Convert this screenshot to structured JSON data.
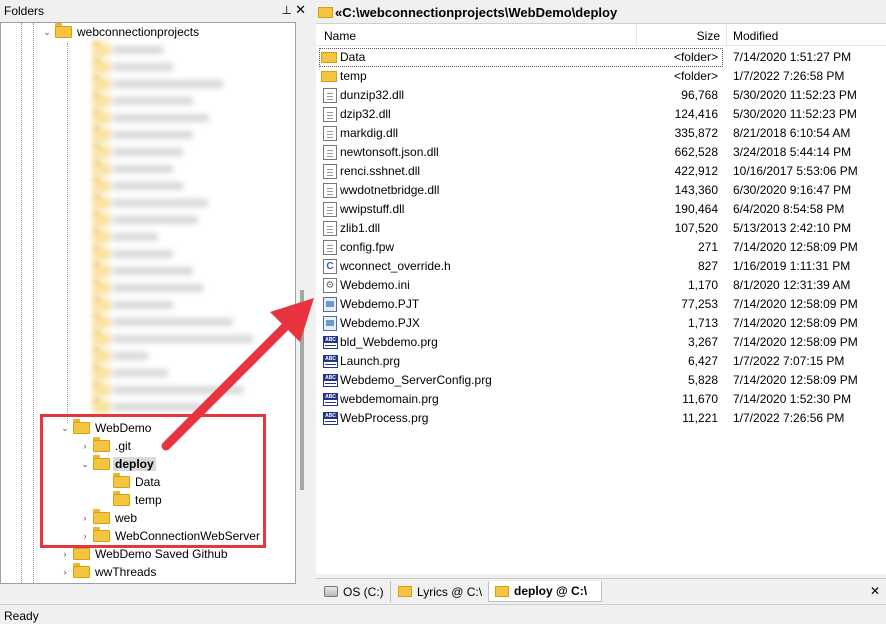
{
  "folders_pane": {
    "title": "Folders",
    "pin_glyph": "⊥",
    "close_glyph": "✕",
    "tree": {
      "root": "webconnectionprojects",
      "blurred_items": [
        "",
        "",
        "",
        "",
        "",
        "",
        "",
        "",
        "",
        "",
        "",
        "",
        "",
        "",
        "",
        "",
        "",
        "",
        "",
        "",
        "",
        ""
      ],
      "webdemo": "WebDemo",
      "git": ".git",
      "deploy": "deploy",
      "data": "Data",
      "temp": "temp",
      "web": "web",
      "wcws": "WebConnectionWebServer",
      "saved": "WebDemo Saved Github",
      "wwthreads": "wwThreads"
    }
  },
  "path_bar": {
    "prefix": "«",
    "path": "C:\\webconnectionprojects\\WebDemo\\deploy"
  },
  "file_list": {
    "columns": {
      "name": "Name",
      "size": "Size",
      "modified": "Modified"
    },
    "rows": [
      {
        "icon": "folder-icon",
        "name": "Data",
        "size": "<folder>",
        "modified": "7/14/2020 1:51:27 PM"
      },
      {
        "icon": "folder-icon",
        "name": "temp",
        "size": "<folder>",
        "modified": "1/7/2022 7:26:58 PM"
      },
      {
        "icon": "dll-file-icon",
        "name": "dunzip32.dll",
        "size": "96,768",
        "modified": "5/30/2020 11:52:23 PM"
      },
      {
        "icon": "dll-file-icon",
        "name": "dzip32.dll",
        "size": "124,416",
        "modified": "5/30/2020 11:52:23 PM"
      },
      {
        "icon": "dll-file-icon",
        "name": "markdig.dll",
        "size": "335,872",
        "modified": "8/21/2018 6:10:54 AM"
      },
      {
        "icon": "dll-file-icon",
        "name": "newtonsoft.json.dll",
        "size": "662,528",
        "modified": "3/24/2018 5:44:14 PM"
      },
      {
        "icon": "dll-file-icon",
        "name": "renci.sshnet.dll",
        "size": "422,912",
        "modified": "10/16/2017 5:53:06 PM"
      },
      {
        "icon": "dll-file-icon",
        "name": "wwdotnetbridge.dll",
        "size": "143,360",
        "modified": "6/30/2020 9:16:47 PM"
      },
      {
        "icon": "dll-file-icon",
        "name": "wwipstuff.dll",
        "size": "190,464",
        "modified": "6/4/2020 8:54:58 PM"
      },
      {
        "icon": "dll-file-icon",
        "name": "zlib1.dll",
        "size": "107,520",
        "modified": "5/13/2013 2:42:10 PM"
      },
      {
        "icon": "blank-file-icon",
        "name": "config.fpw",
        "size": "271",
        "modified": "7/14/2020 12:58:09 PM"
      },
      {
        "icon": "c-header-icon",
        "name": "wconnect_override.h",
        "size": "827",
        "modified": "1/16/2019 1:11:31 PM"
      },
      {
        "icon": "ini-gear-icon",
        "name": "Webdemo.ini",
        "size": "1,170",
        "modified": "8/1/2020 12:31:39 AM"
      },
      {
        "icon": "project-file-icon",
        "name": "Webdemo.PJT",
        "size": "77,253",
        "modified": "7/14/2020 12:58:09 PM"
      },
      {
        "icon": "project-file-icon",
        "name": "Webdemo.PJX",
        "size": "1,713",
        "modified": "7/14/2020 12:58:09 PM"
      },
      {
        "icon": "prg-file-icon",
        "name": "bld_Webdemo.prg",
        "size": "3,267",
        "modified": "7/14/2020 12:58:09 PM"
      },
      {
        "icon": "prg-file-icon",
        "name": "Launch.prg",
        "size": "6,427",
        "modified": "1/7/2022 7:07:15 PM"
      },
      {
        "icon": "prg-file-icon",
        "name": "Webdemo_ServerConfig.prg",
        "size": "5,828",
        "modified": "7/14/2020 12:58:09 PM"
      },
      {
        "icon": "prg-file-icon",
        "name": "webdemomain.prg",
        "size": "11,670",
        "modified": "7/14/2020 1:52:30 PM"
      },
      {
        "icon": "prg-file-icon",
        "name": "WebProcess.prg",
        "size": "11,221",
        "modified": "1/7/2022 7:26:56 PM"
      }
    ]
  },
  "tabs": [
    {
      "icon": "drive-icon",
      "label": "OS (C:)",
      "active": false
    },
    {
      "icon": "folder-icon",
      "label": "Lyrics @ C:\\",
      "active": false
    },
    {
      "icon": "folder-icon",
      "label": "deploy @ C:\\",
      "active": true
    }
  ],
  "tab_close_glyph": "✕",
  "status": "Ready",
  "colors": {
    "annotation_red": "#e7343f",
    "folder_yellow": "#f5c542",
    "selection_gray": "#d9d9d9"
  }
}
